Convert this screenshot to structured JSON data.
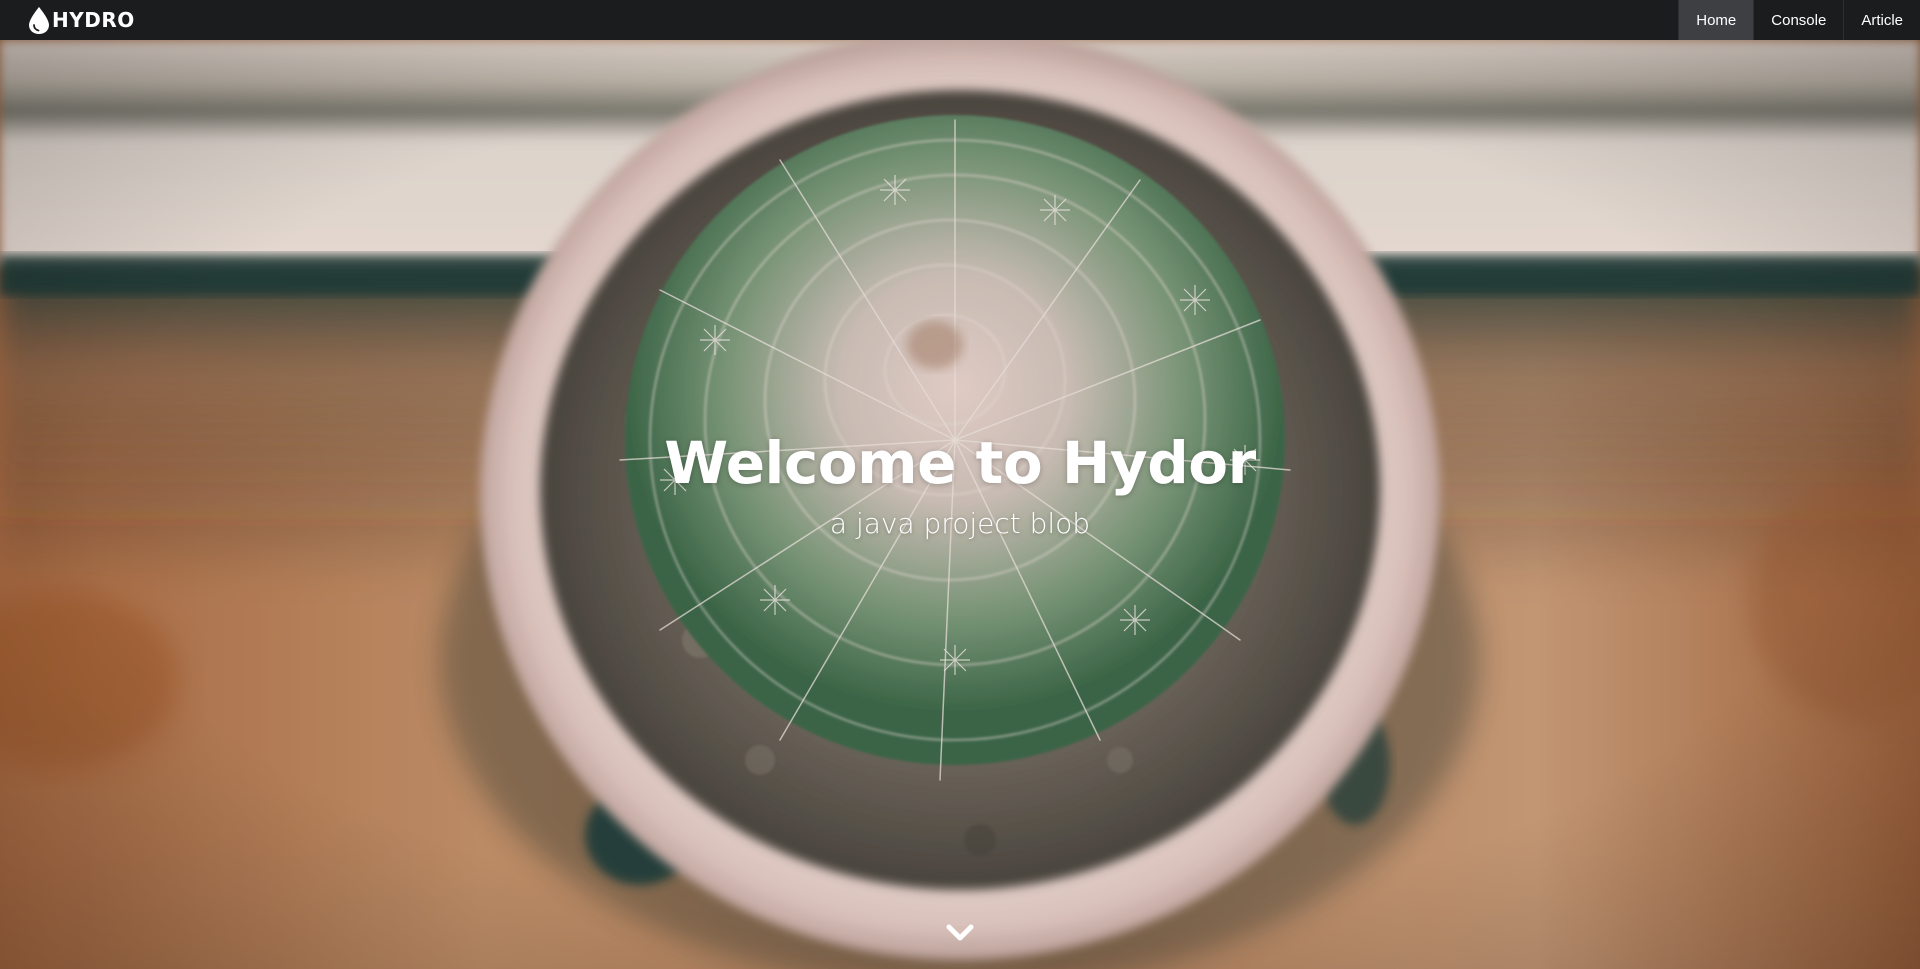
{
  "brand": {
    "name": "HYDRO",
    "icon": "water-drop-icon"
  },
  "nav": {
    "items": [
      {
        "label": "Home",
        "active": true
      },
      {
        "label": "Console",
        "active": false
      },
      {
        "label": "Article",
        "active": false
      }
    ]
  },
  "hero": {
    "title": "Welcome to Hydor",
    "subtitle": "a java project blob",
    "scroll_icon": "chevron-down-icon",
    "image_subject": "cactus-in-pot-icon"
  },
  "colors": {
    "navbar_bg": "#1b1c1e",
    "nav_active_bg": "#3e3f42",
    "text": "#ffffff"
  }
}
